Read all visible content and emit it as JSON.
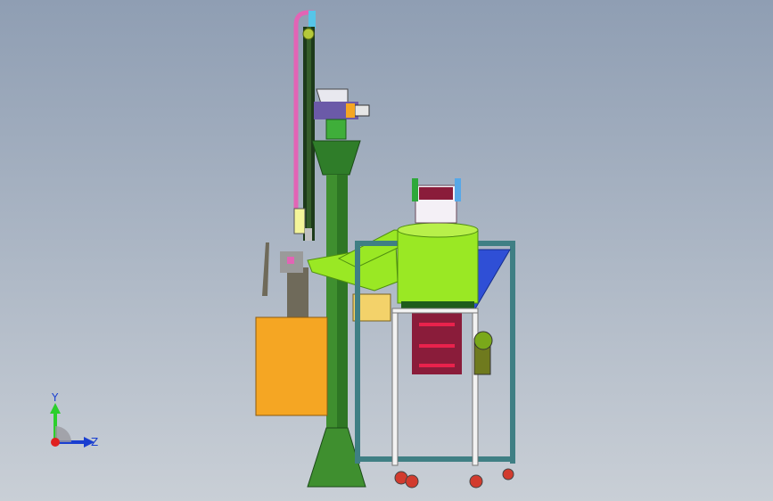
{
  "viewport": {
    "background_top": "#8f9eb3",
    "background_bottom": "#c9cfd6"
  },
  "model": {
    "colors": {
      "frame": "#2d6b2a",
      "column": "#3f8f2f",
      "column_dark": "#255c1e",
      "lime": "#9ae824",
      "lime_dark": "#4f8e10",
      "orange": "#f5a623",
      "yellow": "#f3d26a",
      "pink": "#e264b5",
      "blue_hopper": "#2f4fd6",
      "maroon": "#8a1c3a",
      "red_accent": "#e8224c",
      "cyan": "#57c5e8",
      "gray_part": "#6f6a5a",
      "teal_frame": "#3f7f84",
      "wheel": "#d23b2e",
      "white_part": "#f2f2f2"
    }
  },
  "triad": {
    "y_label": "Y",
    "z_label": "Z",
    "y_color": "#2ccf2c",
    "z_color": "#1a3fd0",
    "x_color": "#e02020"
  }
}
